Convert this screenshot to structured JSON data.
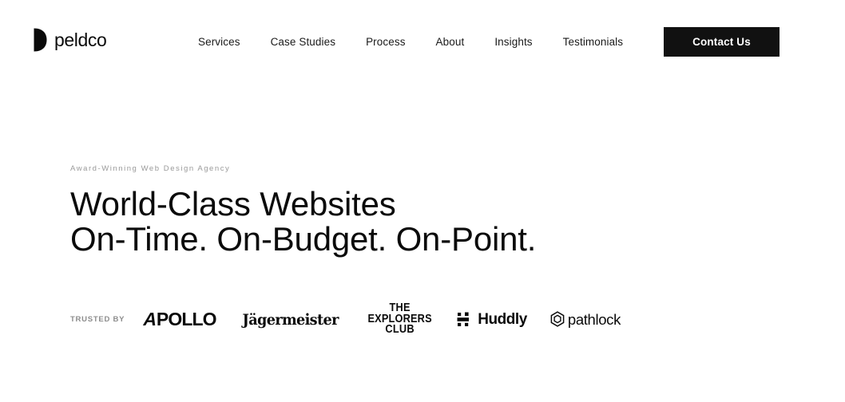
{
  "site": {
    "background_color": "#ffffff",
    "text_color": "#0b0b0b"
  },
  "header": {
    "brand": {
      "name": "peldco",
      "mark_icon": "half-moon-mark"
    },
    "nav_items": [
      {
        "label": "Services"
      },
      {
        "label": "Case Studies"
      },
      {
        "label": "Process"
      },
      {
        "label": "About"
      },
      {
        "label": "Insights"
      },
      {
        "label": "Testimonials"
      }
    ],
    "cta": {
      "label": "Contact Us",
      "background_color": "#111111",
      "text_color": "#ffffff"
    }
  },
  "hero": {
    "eyebrow": "Award-Winning Web Design Agency",
    "eyebrow_color": "#9a9a9a",
    "headline_line1": "World-Class Websites",
    "headline_line2": "On-Time. On-Budget. On-Point."
  },
  "trusted_by": {
    "label": "TRUSTED BY",
    "label_color": "#8d8d8d",
    "logos": [
      {
        "name": "Apollo",
        "letter_a": "A",
        "rest": "POLLO",
        "icon": "apollo-wordmark"
      },
      {
        "name": "Jägermeister",
        "text": "Jägermeister",
        "icon": "jagermeister-wordmark"
      },
      {
        "name": "The Explorers Club",
        "line1": "THE",
        "line2": "EXPLORERS",
        "line3": "CLUB",
        "icon": "explorers-club-wordmark"
      },
      {
        "name": "Huddly",
        "text": "Huddly",
        "icon": "huddly-mark"
      },
      {
        "name": "Pathlock",
        "text": "pathlock",
        "icon": "pathlock-hexagon-mark"
      }
    ]
  }
}
